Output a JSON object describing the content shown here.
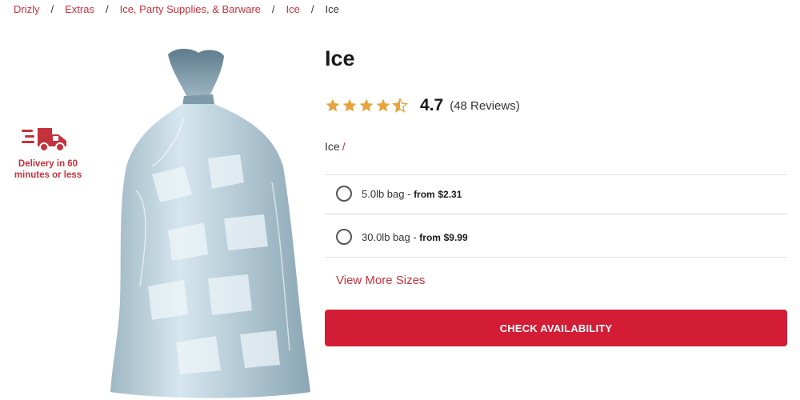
{
  "breadcrumb": {
    "items": [
      "Drizly",
      "Extras",
      "Ice, Party Supplies, & Barware",
      "Ice"
    ],
    "current": "Ice",
    "separator": "/"
  },
  "delivery": {
    "icon": "truck-icon",
    "line1": "Delivery in 60",
    "line2": "minutes or less"
  },
  "product": {
    "title": "Ice",
    "rating": {
      "value": "4.7",
      "stars": 4.5,
      "max_stars": 5,
      "reviews_label": "(48 Reviews)"
    },
    "category": "Ice",
    "category_separator": "/",
    "sizes": [
      {
        "label": "5.0lb bag",
        "dash": " - ",
        "price_prefix": "from",
        "price": "$2.31"
      },
      {
        "label": "30.0lb bag",
        "dash": " - ",
        "price_prefix": "from",
        "price": "$9.99"
      }
    ],
    "view_more_label": "View More Sizes",
    "cta_label": "CHECK AVAILABILITY"
  },
  "colors": {
    "accent": "#c4323d",
    "cta": "#d31c35",
    "star": "#e8a33c"
  }
}
